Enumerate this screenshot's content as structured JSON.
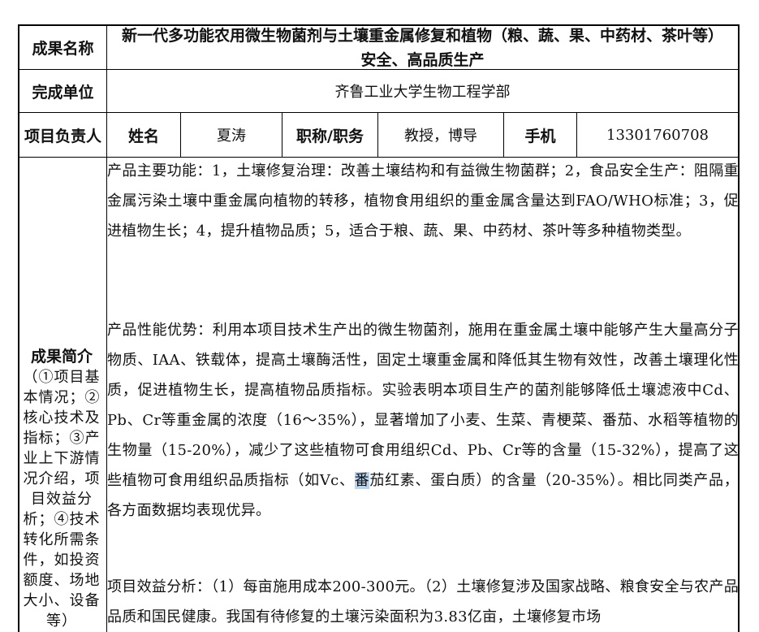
{
  "row1": {
    "label": "成果名称",
    "title": "新一代多功能农用微生物菌剂与土壤重金属修复和植物（粮、蔬、果、中药材、茶叶等）安全、高品质生产"
  },
  "row2": {
    "label": "完成单位",
    "value": "齐鲁工业大学生物工程学部"
  },
  "row3": {
    "label": "项目负责人",
    "name_label": "姓名",
    "name_value": "夏涛",
    "title_label": "职称/职务",
    "title_value": "教授，博导",
    "phone_label": "手机",
    "phone_value": "13301760708"
  },
  "intro": {
    "label": "成果简介",
    "sub": "（①项目基本情况；②核心技术及指标；③产业上下游情况介绍，项目效益分析；④技术转化所需条件，如投资额度、场地大小、设备等）",
    "p1": "产品主要功能：1，土壤修复治理：改善土壤结构和有益微生物菌群；2，食品安全生产：阻隔重金属污染土壤中重金属向植物的转移，植物食用组织的重金属含量达到FAO/WHO标准；3，促进植物生长；4，提升植物品质；5，适合于粮、蔬、果、中药材、茶叶等多种植物类型。",
    "p2_before": "产品性能优势：利用本项目技术生产出的微生物菌剂，施用在重金属土壤中能够产生大量高分子物质、IAA、铁载体，提高土壤酶活性，固定土壤重金属和降低其生物有效性，改善土壤理化性质，促进植物生长，提高植物品质指标。实验表明本项目生产的菌剂能够降低土壤滤液中Cd、Pb、Cr等重金属的浓度（16～35%），显著增加了小麦、生菜、青梗菜、番茄、水稻等植物的生物量（15-20%），减少了这些植物可食用组织Cd、Pb、Cr等的含量（15-32%），提高了这些植物可食用组织品质指标（如Vc、",
    "p2_hl": "番",
    "p2_after": "茄红素、蛋白质）的含量（20-35%）。相比同类产品，各方面数据均表现优异。",
    "p3": "项目效益分析：（1）每亩施用成本200-300元。（2）土壤修复涉及国家战略、粮食安全与农产品品质和国民健康。我国有待修复的土壤污染面积为3.83亿亩，土壤修复市场"
  }
}
